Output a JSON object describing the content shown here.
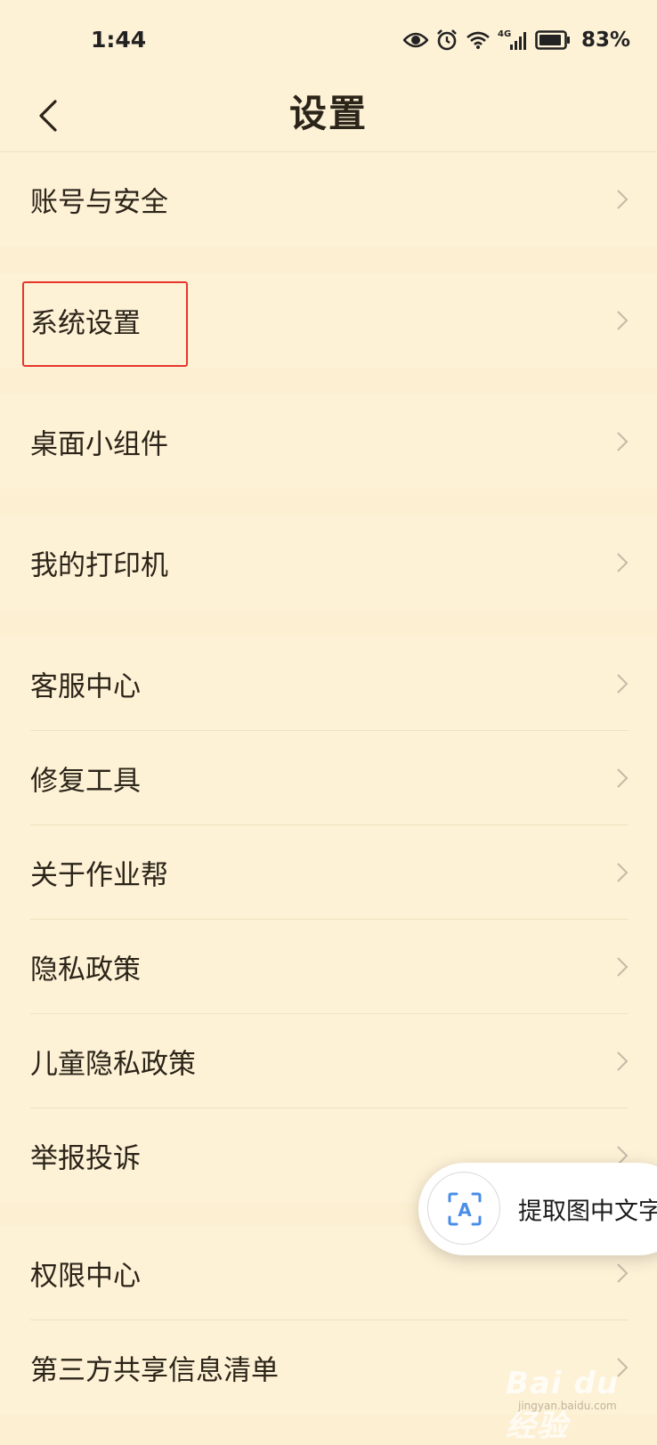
{
  "status_bar": {
    "time": "1:44",
    "network": "4G",
    "battery": "83%"
  },
  "header": {
    "title": "设置"
  },
  "sections": [
    {
      "items": [
        {
          "label": "账号与安全"
        }
      ]
    },
    {
      "items": [
        {
          "label": "系统设置"
        }
      ]
    },
    {
      "items": [
        {
          "label": "桌面小组件"
        }
      ]
    },
    {
      "items": [
        {
          "label": "我的打印机"
        }
      ]
    },
    {
      "items": [
        {
          "label": "客服中心"
        },
        {
          "label": "修复工具"
        },
        {
          "label": "关于作业帮"
        },
        {
          "label": "隐私政策"
        },
        {
          "label": "儿童隐私政策"
        },
        {
          "label": "举报投诉"
        }
      ]
    },
    {
      "items": [
        {
          "label": "权限中心"
        },
        {
          "label": "第三方共享信息清单"
        }
      ]
    }
  ],
  "floating_action": {
    "label": "提取图中文字",
    "icon": "text-recognition-icon"
  },
  "watermark": {
    "text": "Bai du 经验",
    "sub": "jingyan.baidu.com"
  },
  "colors": {
    "background": "#fdf0d2",
    "highlight": "#e8362e"
  }
}
